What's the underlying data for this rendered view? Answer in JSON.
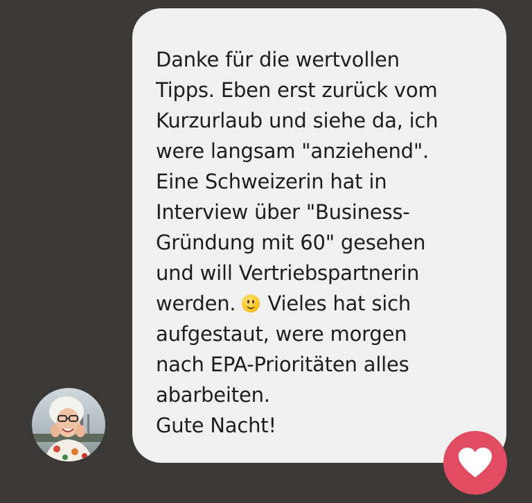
{
  "message": {
    "lines": [
      "Danke für die wertvollen",
      "Tipps. Eben erst zurück vom",
      "Kurzurlaub und siehe da, ich",
      "were langsam \"anziehend\".",
      "Eine Schweizerin hat in",
      "Interview über \"Business-",
      "Gründung mit 60\" gesehen",
      "und will Vertriebspartnerin",
      "werden.",
      "Vieles hat sich",
      "aufgestaut, were morgen",
      "nach EPA-Prioritäten alles",
      "abarbeiten.",
      "Gute Nacht!"
    ],
    "emoji": "slightly-smiling-face-icon"
  },
  "avatar": {
    "description_icon": "user-avatar-photo"
  },
  "reaction": {
    "icon": "heart-icon",
    "color": "#e14c63"
  },
  "colors": {
    "background": "#3b3938",
    "bubble": "#f0f0f0",
    "text": "#1d1d1d"
  }
}
